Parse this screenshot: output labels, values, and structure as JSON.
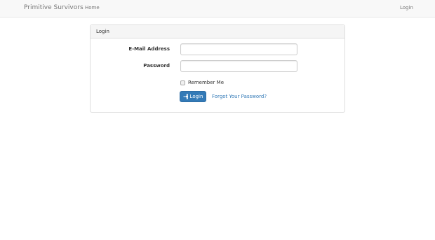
{
  "navbar": {
    "brand": "Primitive Survivors",
    "home_label": "Home",
    "login_label": "Login"
  },
  "panel": {
    "title": "Login",
    "email_label": "E-Mail Address",
    "email_value": "",
    "password_label": "Password",
    "password_value": "",
    "remember_label": "Remember Me",
    "remember_checked": false,
    "login_button_label": "Login",
    "login_button_icon": "sign-in-icon",
    "forgot_link": "Forgot Your Password?"
  },
  "colors": {
    "primary": "#337ab7",
    "navbar_bg": "#f8f8f8",
    "panel_heading_bg": "#f5f5f5",
    "nav_text": "#777777"
  }
}
